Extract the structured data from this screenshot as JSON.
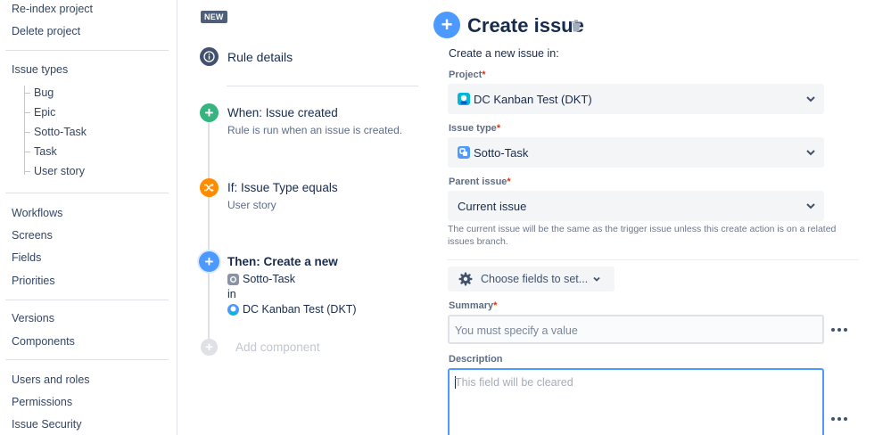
{
  "sidebar": {
    "top_links": [
      "Re-index project",
      "Delete project"
    ],
    "issue_types_label": "Issue types",
    "issue_types": [
      "Bug",
      "Epic",
      "Sotto-Task",
      "Task",
      "User story"
    ],
    "group2": [
      "Workflows",
      "Screens",
      "Fields",
      "Priorities"
    ],
    "group3": [
      "Versions",
      "Components"
    ],
    "group4": [
      "Users and roles",
      "Permissions",
      "Issue Security"
    ]
  },
  "rule": {
    "badge": "NEW",
    "details_label": "Rule details",
    "trigger": {
      "title": "When: Issue created",
      "desc": "Rule is run when an issue is created."
    },
    "condition": {
      "title": "If: Issue Type equals",
      "desc": "User story"
    },
    "action": {
      "title": "Then: Create a new",
      "issue_type": "Sotto-Task",
      "in_label": "in",
      "project": "DC Kanban Test (DKT)"
    },
    "add_component": "Add component"
  },
  "create_issue": {
    "title": "Create issue",
    "subtitle": "Create a new issue in:",
    "project": {
      "label": "Project",
      "required": "*",
      "value": "DC Kanban Test (DKT)"
    },
    "issue_type": {
      "label": "Issue type",
      "required": "*",
      "value": "Sotto-Task"
    },
    "parent": {
      "label": "Parent issue",
      "required": "*",
      "value": "Current issue"
    },
    "helper": "The current issue will be the same as the trigger issue unless this create action is on a related issues branch.",
    "choose_fields": "Choose fields to set...",
    "summary": {
      "label": "Summary",
      "required": "*",
      "placeholder": "You must specify a value"
    },
    "description": {
      "label": "Description",
      "placeholder": "This field will be cleared"
    }
  },
  "colors": {
    "green": "#36b37e",
    "orange": "#ff8b00",
    "blue": "#4c9aff",
    "dark_blue": "#42526e",
    "required": "#de350b"
  }
}
